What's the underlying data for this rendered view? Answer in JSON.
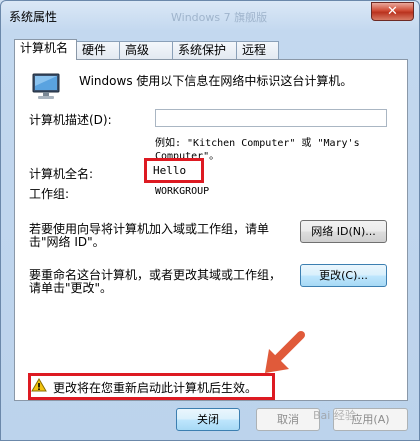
{
  "window": {
    "title": "系统属性",
    "ghost_title": "Windows 7 旗舰版",
    "close_glyph": "✕"
  },
  "tabs": [
    {
      "label": "计算机名",
      "active": true
    },
    {
      "label": "硬件",
      "active": false
    },
    {
      "label": "高级",
      "active": false
    },
    {
      "label": "系统保护",
      "active": false
    },
    {
      "label": "远程",
      "active": false
    }
  ],
  "panel": {
    "intro": "Windows 使用以下信息在网络中标识这台计算机。",
    "description_label": "计算机描述(D):",
    "description_value": "",
    "example_line1": "例如: \"Kitchen Computer\" 或 \"Mary's",
    "example_line2": "Computer\"。",
    "fullname_label": "计算机全名:",
    "fullname_value": "Hello",
    "workgroup_label": "工作组:",
    "workgroup_value": "WORKGROUP",
    "network_text_line1": "若要使用向导将计算机加入域或工作组，请单",
    "network_text_line2": "击\"网络 ID\"。",
    "network_button": "网络 ID(N)...",
    "rename_text_line1": "要重命名这台计算机，或者更改其域或工作组，",
    "rename_text_line2": "请单击\"更改\"。",
    "change_button": "更改(C)...",
    "warning_text": "更改将在您重新启动此计算机后生效。"
  },
  "buttons": {
    "close": "关闭",
    "cancel": "取消",
    "apply": "应用(A)"
  },
  "watermark": "Bai 经验",
  "colors": {
    "highlight_red": "#dd1a22",
    "arrow": "#e05a3a"
  }
}
